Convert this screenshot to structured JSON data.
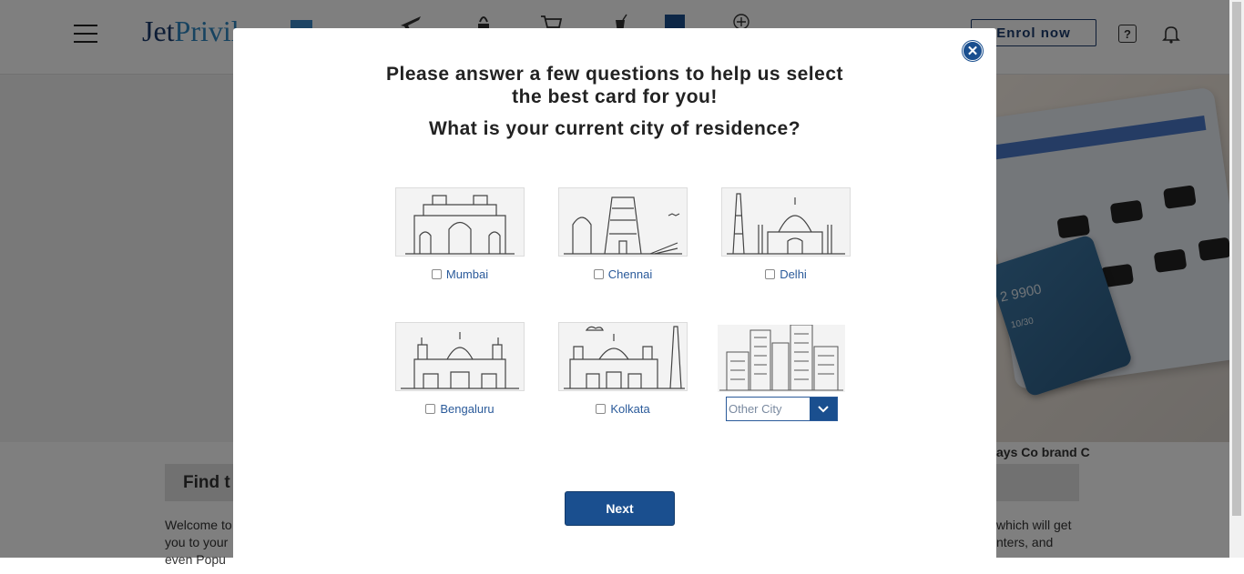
{
  "header": {
    "logo_text_1": "Jet",
    "logo_text_2": "Privil",
    "enrol_label": "Enrol now",
    "help_label": "?"
  },
  "background": {
    "partner_text": "ays Co brand C",
    "find_title": "Find t",
    "welcome_left": [
      "Welcome to",
      "you to your",
      "even Popu"
    ],
    "welcome_right": [
      "which will get",
      "nters, and",
      ""
    ],
    "card_number": "2 9900",
    "card_expiry": "10/30"
  },
  "modal": {
    "question_line1": "Please answer a few questions to help us select",
    "question_line2": "the best card for you!",
    "question_city": "What is your current city of residence?",
    "cities": [
      {
        "label": "Mumbai"
      },
      {
        "label": "Chennai"
      },
      {
        "label": "Delhi"
      },
      {
        "label": "Bengaluru"
      },
      {
        "label": "Kolkata"
      }
    ],
    "other_city_placeholder": "Other City",
    "next_label": "Next"
  },
  "colors": {
    "primary": "#1a4f8f",
    "link": "#2a5a9a",
    "overlay": "rgba(0,0,0,0.5)"
  }
}
